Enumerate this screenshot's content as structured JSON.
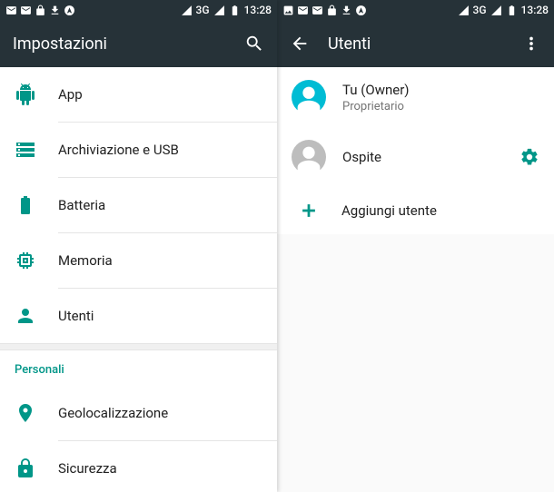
{
  "status": {
    "network": "3G",
    "time": "13:28"
  },
  "left": {
    "title": "Impostazioni",
    "items": [
      {
        "icon": "android-icon",
        "label": "App"
      },
      {
        "icon": "storage-icon",
        "label": "Archiviazione e USB"
      },
      {
        "icon": "battery-icon",
        "label": "Batteria"
      },
      {
        "icon": "memory-icon",
        "label": "Memoria"
      },
      {
        "icon": "user-icon",
        "label": "Utenti"
      }
    ],
    "section_title": "Personali",
    "personal": [
      {
        "icon": "location-icon",
        "label": "Geolocalizzazione"
      },
      {
        "icon": "lock-icon",
        "label": "Sicurezza"
      }
    ]
  },
  "right": {
    "title": "Utenti",
    "owner": {
      "name": "Tu (Owner)",
      "sub": "Proprietario"
    },
    "guest": {
      "name": "Ospite"
    },
    "add_label": "Aggiungi utente"
  }
}
